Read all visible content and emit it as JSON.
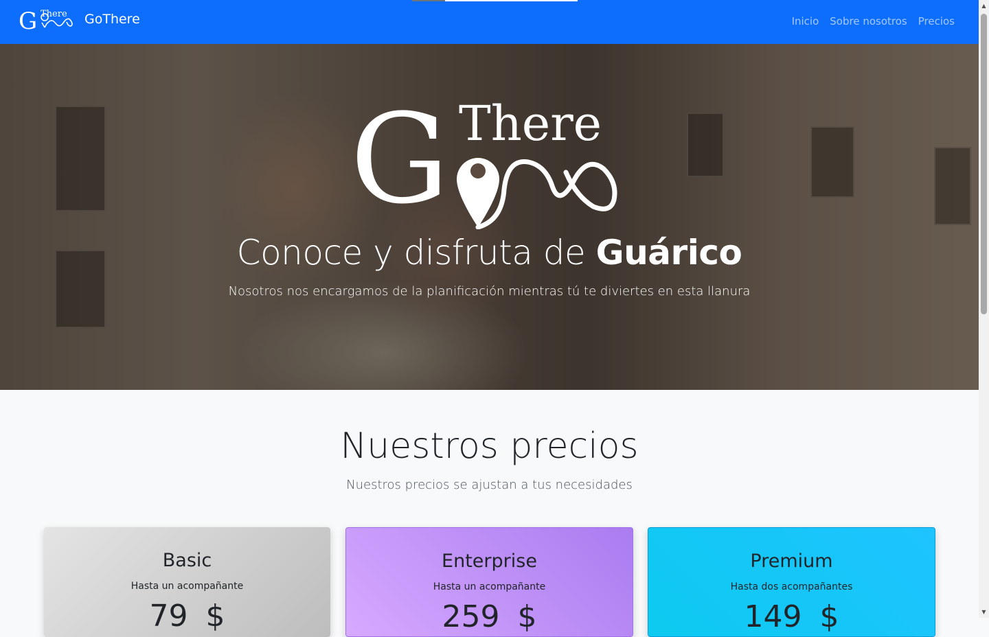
{
  "navbar": {
    "logo_text_small": "There",
    "logo_text_big": "G",
    "brand": "GoThere",
    "links": [
      "Inicio",
      "Sobre nosotros",
      "Precios"
    ],
    "progress_fraction": 0.2
  },
  "hero": {
    "logo_big": "G",
    "logo_small": "There",
    "title_prefix": "Conoce y disfruta de ",
    "title_highlight": "Guárico",
    "subtitle": "Nosotros nos encargamos de la planificación mientras tú te diviertes en esta llanura"
  },
  "pricing": {
    "title": "Nuestros precios",
    "subtitle": "Nuestros precios se ajustan a tus necesidades",
    "plans": [
      {
        "name": "Basic",
        "description": "Hasta un acompañante",
        "price": "79",
        "currency": "$"
      },
      {
        "name": "Enterprise",
        "description": "Hasta un acompañante",
        "price": "259",
        "currency": "$"
      },
      {
        "name": "Premium",
        "description": "Hasta dos acompañantes",
        "price": "149",
        "currency": "$"
      }
    ]
  },
  "scrollbar": {
    "up_icon": "arrow-up-icon",
    "down_icon": "arrow-down-icon"
  },
  "colors": {
    "navbar": "#0d6efd",
    "basic": "#cfcfcf",
    "enterprise": "#c39bff",
    "premium": "#0dcaf0"
  }
}
